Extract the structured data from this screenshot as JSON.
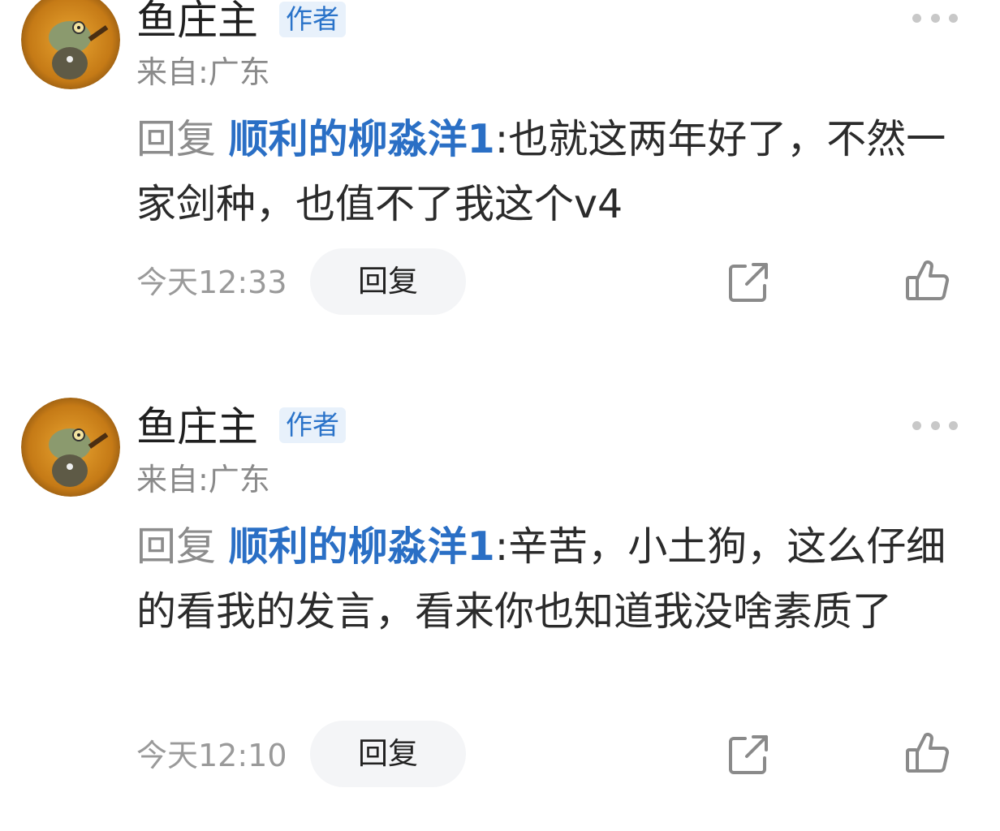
{
  "comments": [
    {
      "author": "鱼庄主",
      "badge": "作者",
      "location": "来自:广东",
      "reply_prefix": "回复",
      "mention": "顺利的柳淼洋1",
      "separator": ":",
      "text": "也就这两年好了，不然一家剑种，也值不了我这个v4",
      "time": "今天12:33",
      "reply_label": "回复"
    },
    {
      "author": "鱼庄主",
      "badge": "作者",
      "location": "来自:广东",
      "reply_prefix": "回复",
      "mention": "顺利的柳淼洋1",
      "separator": ":",
      "text": "辛苦，小土狗，这么仔细的看我的发言，看来你也知道我没啥素质了",
      "time": "今天12:10",
      "reply_label": "回复"
    }
  ],
  "icons": {
    "more": "more-dots-icon",
    "share": "share-icon",
    "like": "thumbs-up-icon"
  },
  "colors": {
    "mention": "#2a6fc5",
    "badge_bg": "#e8f1fb",
    "badge_text": "#2a73c9",
    "muted": "#8a8a8a"
  }
}
